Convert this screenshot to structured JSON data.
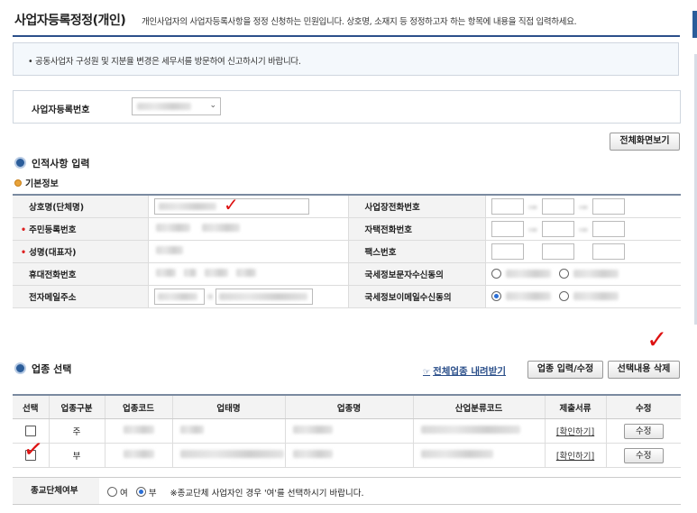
{
  "header": {
    "title": "사업자등록정정(개인)",
    "subtitle": "개인사업자의 사업자등록사항을 정정 신청하는 민원입니다. 상호명, 소재지 등 정정하고자 하는 항목에 내용을 직접 입력하세요."
  },
  "notice": "• 공동사업자 구성원 및 지분율 변경은 세무서를 방문하여 신고하시기 바랍니다.",
  "bizno": {
    "label": "사업자등록번호"
  },
  "buttons": {
    "fullscreen": "전체화면보기",
    "industry_input": "업종 입력/수정",
    "delete_selected": "선택내용 삭제",
    "edit": "수정"
  },
  "personal": {
    "section_title": "인적사항 입력",
    "basic_title": "기본정보",
    "rows": [
      {
        "left_label": "상호명(단체명)",
        "left_required": false,
        "right_label": "사업장전화번호"
      },
      {
        "left_label": "주민등록번호",
        "left_required": true,
        "right_label": "자택전화번호"
      },
      {
        "left_label": "성명(대표자)",
        "left_required": true,
        "right_label": "팩스번호"
      },
      {
        "left_label": "휴대전화번호",
        "left_required": false,
        "right_label": "국세정보문자수신동의"
      },
      {
        "left_label": "전자메일주소",
        "left_required": false,
        "right_label": "국세정보이메일수신동의"
      }
    ]
  },
  "industry": {
    "section_title": "업종 선택",
    "all_link": "전체업종 내려받기",
    "columns": [
      "선택",
      "업종구분",
      "업종코드",
      "업태명",
      "업종명",
      "산업분류코드",
      "제출서류",
      "수정"
    ],
    "rows": [
      {
        "type": "주",
        "doc": "[확인하기]"
      },
      {
        "type": "부",
        "doc": "[확인하기]"
      }
    ]
  },
  "religion": {
    "label": "종교단체여부",
    "yes": "여",
    "no": "부",
    "selected": "부",
    "note": "※종교단체 사업자인 경우 '여'를 선택하시기 바랍니다."
  },
  "colors": {
    "accent": "#2b4f8a",
    "annotation_check": "#d11111",
    "required": "#dd2222"
  }
}
